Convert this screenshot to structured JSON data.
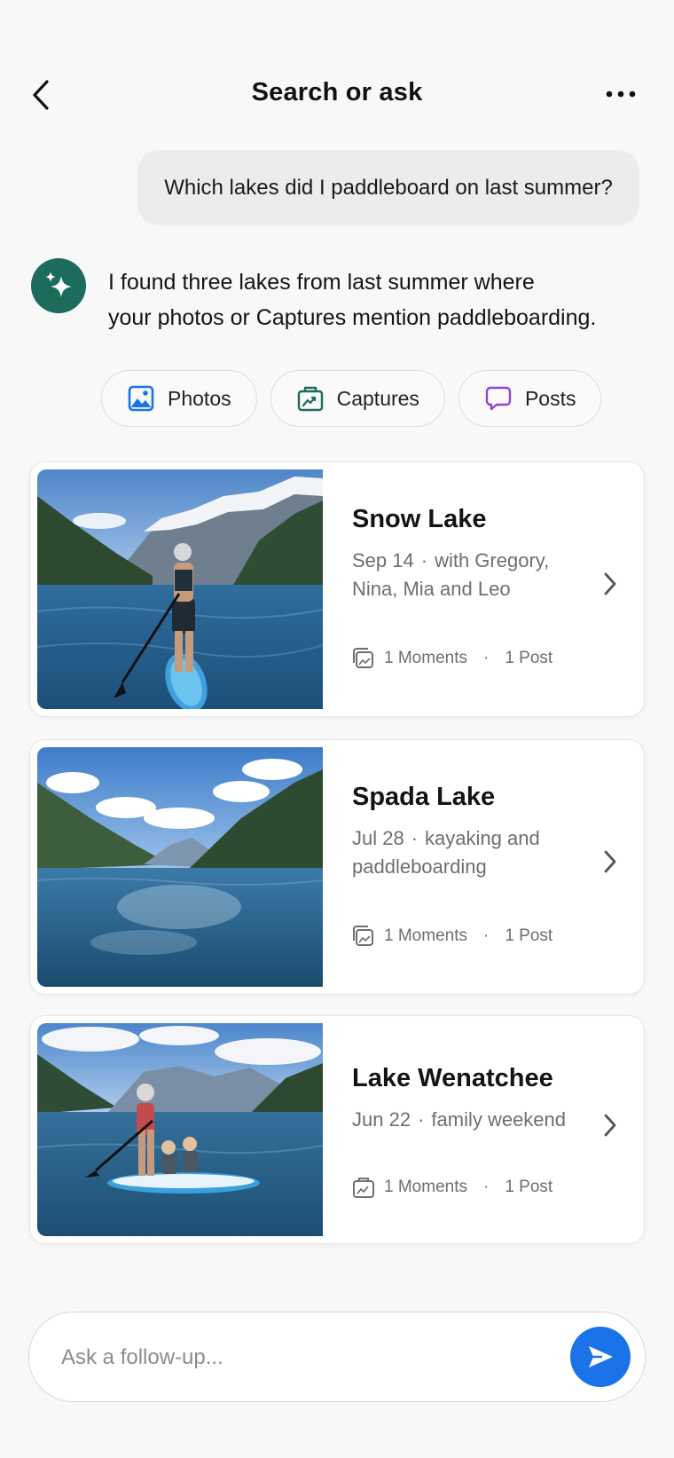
{
  "header": {
    "title": "Search or ask",
    "back_icon": "chevron-left-icon",
    "more_icon": "more-horizontal-icon"
  },
  "conversation": {
    "user_query": "Which lakes did I paddleboard on last summer?",
    "assistant_avatar_icon": "sparkle-icon",
    "assistant_reply_line1": "I found three lakes from last summer where",
    "assistant_reply_line2": "your photos or Captures mention paddleboarding."
  },
  "filters": [
    {
      "label": "Photos",
      "icon": "photo-icon",
      "color": "#1a73e8"
    },
    {
      "label": "Captures",
      "icon": "captures-icon",
      "color": "#1d6b5c"
    },
    {
      "label": "Posts",
      "icon": "chat-bubble-icon",
      "color": "#8e44d9"
    }
  ],
  "results": [
    {
      "name": "Snow Lake",
      "date": "Sep 14",
      "detail": "with Gregory,",
      "detail_line2": "Nina, Mia and Leo",
      "moments": "1 Moments",
      "posts": "1 Post",
      "stats_icon": "moments-stack-icon"
    },
    {
      "name": "Spada Lake",
      "date": "Jul 28",
      "detail": "kayaking and",
      "detail_line2": "paddleboarding",
      "moments": "1 Moments",
      "posts": "1 Post",
      "stats_icon": "moments-stack-icon"
    },
    {
      "name": "Lake Wenatchee",
      "date": "Jun 22",
      "detail": "family weekend",
      "detail_line2": "",
      "moments": "1 Moments",
      "posts": "1 Post",
      "stats_icon": "captures-icon"
    }
  ],
  "composer": {
    "placeholder": "Ask a follow-up...",
    "send_icon": "send-icon"
  },
  "colors": {
    "accent": "#1a73e8",
    "avatar": "#1d6b5c"
  }
}
